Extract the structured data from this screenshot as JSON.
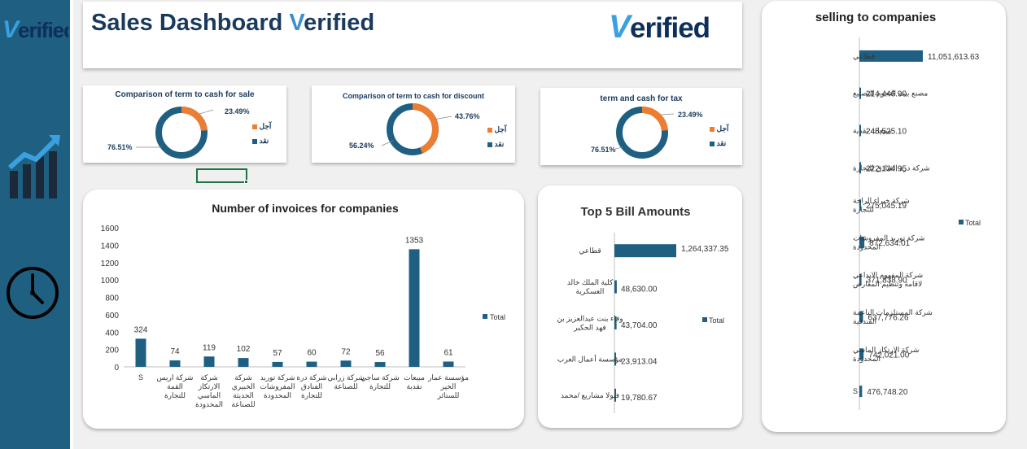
{
  "app": {
    "logo_text": "Verified",
    "title_prefix": "Sales Dashboard ",
    "title_v": "V",
    "title_rest": "erified",
    "brand_logo": "Verified"
  },
  "colors": {
    "primary": "#1f6082",
    "accent": "#ed7d31",
    "sidebar": "#1f6082",
    "title": "#1a3a5c"
  },
  "sidebar": {
    "icons": [
      "growth-chart-icon",
      "clock-icon"
    ]
  },
  "donuts": [
    {
      "title": "Comparison of term to cash for sale",
      "term_pct": "23.49%",
      "cash_pct": "76.51%",
      "term_label": "آجل",
      "cash_label": "نقد",
      "term_value": 23.49,
      "cash_value": 76.51
    },
    {
      "title": "Comparison of term to cash for discount",
      "term_pct": "43.76%",
      "cash_pct": "56.24%",
      "term_label": "آجل",
      "cash_label": "نقد",
      "term_value": 43.76,
      "cash_value": 56.24
    },
    {
      "title": "term and cash for tax",
      "term_pct": "23.49%",
      "cash_pct": "76.51%",
      "term_label": "آجل",
      "cash_label": "نقد",
      "term_value": 23.49,
      "cash_value": 76.51
    }
  ],
  "chart_data": [
    {
      "type": "bar",
      "title": "Number of invoices for companies",
      "categories": [
        "S",
        "شركة اريس القمة للتجارة",
        "شركة الارتكاز الماسي المحدودة",
        "شركة الخبيري الحديثة للصناعة",
        "شركة توريد المفروشات المحدودة",
        "شركة درة الفنادق للتجارة",
        "شركة زرابي للصناعة",
        "شركة ساجي للتجارة",
        "مبيعات نقدية",
        "مؤسسة عمار الخير للستائر"
      ],
      "series": [
        {
          "name": "Total",
          "values": [
            324,
            74,
            119,
            102,
            57,
            60,
            72,
            56,
            1353,
            61
          ]
        }
      ],
      "ylim": [
        0,
        1600
      ],
      "yticks": [
        "0",
        "200",
        "400",
        "600",
        "800",
        "1000",
        "1200",
        "1400",
        "1600"
      ],
      "value_labels": [
        "324",
        "74",
        "119",
        "102",
        "57",
        "60",
        "72",
        "56",
        "1353",
        "61"
      ],
      "legend": "Total"
    },
    {
      "type": "bar",
      "orientation": "horizontal",
      "title": "Top 5 Bill Amounts",
      "categories": [
        "قطاعي",
        "كلية الملك خالد العسكرية",
        "وفاء بنت عبدالعزيز بن فهد الحكير",
        "مؤسسة أعمال العرب",
        "فيولا مشاريع /محمد"
      ],
      "series": [
        {
          "name": "Total",
          "values": [
            1264337.35,
            48630.0,
            43704.0,
            23913.04,
            19780.67
          ]
        }
      ],
      "value_labels": [
        "1,264,337.35",
        "48,630.00",
        "43,704.00",
        "23,913.04",
        "19,780.67"
      ],
      "legend": "Total"
    },
    {
      "type": "bar",
      "orientation": "horizontal",
      "title": "selling to companies",
      "categories": [
        "قطاعي",
        "مصنع بيت النجوم للتصنيع",
        "مبيعات نقدية",
        "شركة درة الفنادق للتجارة",
        "شركة خبراء الراحة للتجارة",
        "شركة توريد المفروشات المحدودة",
        "شركة المفهوم الابداعي لاقامة وتنظيم المعارض",
        "شركة المستلزمات الناعمة الفندقية",
        "شركة الارتكاز الماسي المحدودة",
        "S"
      ],
      "series": [
        {
          "name": "Total",
          "values": [
            11051613.63,
            214446.9,
            245525.1,
            222134.95,
            275045.19,
            872634.01,
            371838.9,
            637776.26,
            742021.0,
            476748.2
          ]
        }
      ],
      "value_labels": [
        "11,051,613.63",
        "214,446.90",
        "245,525.10",
        "222,134.95",
        "275,045.19",
        "872,634.01",
        "371,838.90",
        "637,776.26",
        "742,021.00",
        "476,748.20"
      ],
      "legend": "Total"
    }
  ]
}
